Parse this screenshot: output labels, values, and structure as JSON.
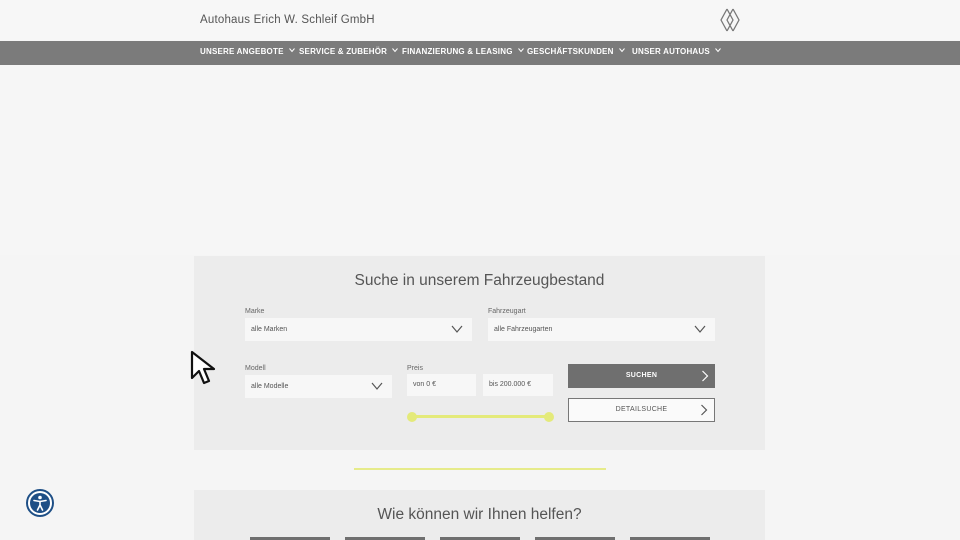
{
  "header": {
    "brand": "Autohaus Erich W. Schleif GmbH",
    "logo_icon": "renault-diamond-icon"
  },
  "nav": {
    "items": [
      {
        "label": "UNSERE ANGEBOTE"
      },
      {
        "label": "SERVICE & ZUBEHÖR"
      },
      {
        "label": "FINANZIERUNG & LEASING"
      },
      {
        "label": "GESCHÄFTSKUNDEN"
      },
      {
        "label": "UNSER AUTOHAUS"
      }
    ]
  },
  "search": {
    "title": "Suche in unserem Fahrzeugbestand",
    "marke": {
      "label": "Marke",
      "value": "alle Marken"
    },
    "fahrzeugart": {
      "label": "Fahrzeugart",
      "value": "alle Fahrzeugarten"
    },
    "modell": {
      "label": "Modell",
      "value": "alle Modelle"
    },
    "preis": {
      "label": "Preis",
      "min_placeholder": "von 0 €",
      "max_placeholder": "bis 200.000 €",
      "range_fraction": [
        0,
        1
      ]
    },
    "submit_label": "SUCHEN",
    "detail_label": "DETAILSUCHE"
  },
  "help": {
    "title": "Wie können wir Ihnen helfen?"
  },
  "colors": {
    "nav_bg": "#7b7b7b",
    "accent": "#e4ea7a",
    "button_dark": "#6f6f6f",
    "a11y_blue": "#1e4f86"
  },
  "icons": {
    "nav_chevron": "chevron-down-icon",
    "select_arrow": "chevron-down-icon",
    "button_arrow": "chevron-right-icon",
    "accessibility": "accessibility-icon",
    "pointer": "mouse-pointer-icon"
  }
}
